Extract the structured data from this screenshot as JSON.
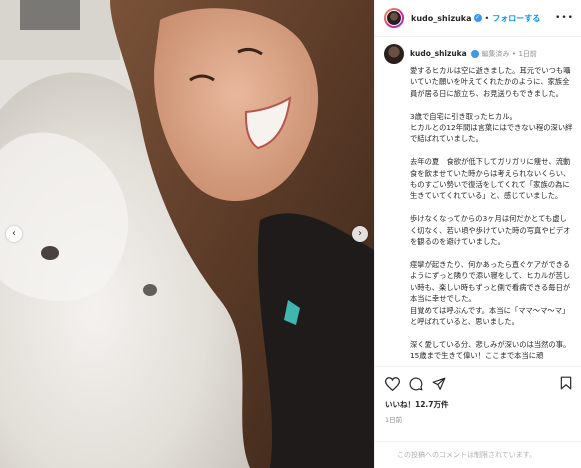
{
  "header": {
    "username": "kudo_shizuka",
    "separator": "•",
    "follow_label": "フォローする",
    "more_label": "•••"
  },
  "caption": {
    "username": "kudo_shizuka",
    "edited_label": "編集済み",
    "separator": "•",
    "time": "1日前",
    "text": "愛するヒカルは空に逝きました。耳元でいつも囁いていた願いを叶えてくれたかのように、家族全員が居る日に旅立ち、お見送りもできました。\n\n3歳で自宅に引き取ったヒカル。\nヒカルとの12年間は言葉にはできない程の深い絆で結ばれていました。\n\n去年の夏　食欲が低下してガリガリに痩せ、流動食を飲ませていた時からは考えられないくらい、ものすごい勢いで復活をしてくれて「家族の為に生きていてくれている」と、感じていました。\n\n歩けなくなってからの3ヶ月は何だかとても虚しく切なく、若い頃や歩けていた時の写真やビデオを観るのを避けていました。\n\n痙攣が起きたり、何かあったら直ぐケアができるようにずっと隣りで添い寝をして、ヒカルが苦しい時も、楽しい時もずっと側で看病できる毎日が本当に幸せでした。\n目覚めては呼ぶんです。本当に「ママ〜マ〜マ」と呼ばれていると、思いました。\n\n深く愛している分、悲しみが深いのは当然の事。15歳まで生きて偉い！ここまで本当に頑"
  },
  "actions": {
    "likes": "いいね！12.7万件",
    "time": "1日前",
    "comments_off": "この投稿へのコメントは制限されています。"
  },
  "media": {
    "prev_arrow": "‹",
    "next_arrow": "›"
  },
  "colors": {
    "follow": "#0095f6",
    "verified": "#3897f0",
    "muted": "#8e8e8e"
  }
}
